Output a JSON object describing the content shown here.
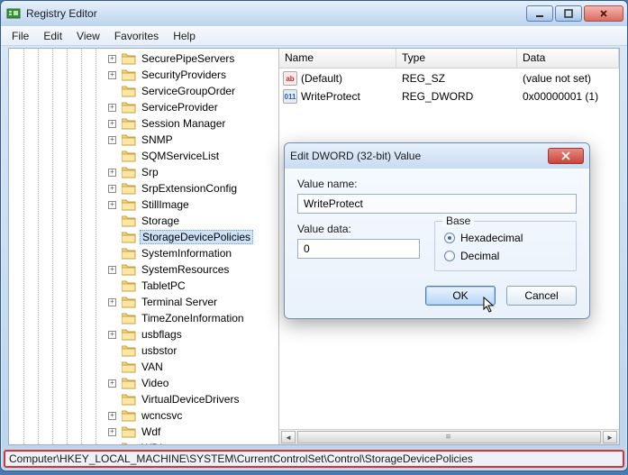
{
  "titlebar": {
    "title": "Registry Editor"
  },
  "menu": {
    "file": "File",
    "edit": "Edit",
    "view": "View",
    "favorites": "Favorites",
    "help": "Help"
  },
  "tree": {
    "items": [
      {
        "label": "SecurePipeServers",
        "exp": "+"
      },
      {
        "label": "SecurityProviders",
        "exp": "+"
      },
      {
        "label": "ServiceGroupOrder",
        "exp": ""
      },
      {
        "label": "ServiceProvider",
        "exp": "+"
      },
      {
        "label": "Session Manager",
        "exp": "+"
      },
      {
        "label": "SNMP",
        "exp": "+"
      },
      {
        "label": "SQMServiceList",
        "exp": ""
      },
      {
        "label": "Srp",
        "exp": "+"
      },
      {
        "label": "SrpExtensionConfig",
        "exp": "+"
      },
      {
        "label": "StillImage",
        "exp": "+"
      },
      {
        "label": "Storage",
        "exp": ""
      },
      {
        "label": "StorageDevicePolicies",
        "exp": "",
        "selected": true
      },
      {
        "label": "SystemInformation",
        "exp": ""
      },
      {
        "label": "SystemResources",
        "exp": "+"
      },
      {
        "label": "TabletPC",
        "exp": ""
      },
      {
        "label": "Terminal Server",
        "exp": "+"
      },
      {
        "label": "TimeZoneInformation",
        "exp": ""
      },
      {
        "label": "usbflags",
        "exp": "+"
      },
      {
        "label": "usbstor",
        "exp": ""
      },
      {
        "label": "VAN",
        "exp": ""
      },
      {
        "label": "Video",
        "exp": "+"
      },
      {
        "label": "VirtualDeviceDrivers",
        "exp": ""
      },
      {
        "label": "wcncsvc",
        "exp": "+"
      },
      {
        "label": "Wdf",
        "exp": "+"
      },
      {
        "label": "WDI",
        "exp": "+"
      }
    ]
  },
  "list": {
    "headers": {
      "name": "Name",
      "type": "Type",
      "data": "Data"
    },
    "rows": [
      {
        "icon": "sz",
        "iconText": "ab",
        "name": "(Default)",
        "type": "REG_SZ",
        "data": "(value not set)"
      },
      {
        "icon": "dw",
        "iconText": "011",
        "name": "WriteProtect",
        "type": "REG_DWORD",
        "data": "0x00000001 (1)"
      }
    ]
  },
  "status": {
    "path": "Computer\\HKEY_LOCAL_MACHINE\\SYSTEM\\CurrentControlSet\\Control\\StorageDevicePolicies"
  },
  "dialog": {
    "title": "Edit DWORD (32-bit) Value",
    "valueNameLabel": "Value name:",
    "valueName": "WriteProtect",
    "valueDataLabel": "Value data:",
    "valueData": "0",
    "baseLabel": "Base",
    "hex": "Hexadecimal",
    "dec": "Decimal",
    "baseSelected": "hex",
    "ok": "OK",
    "cancel": "Cancel"
  }
}
